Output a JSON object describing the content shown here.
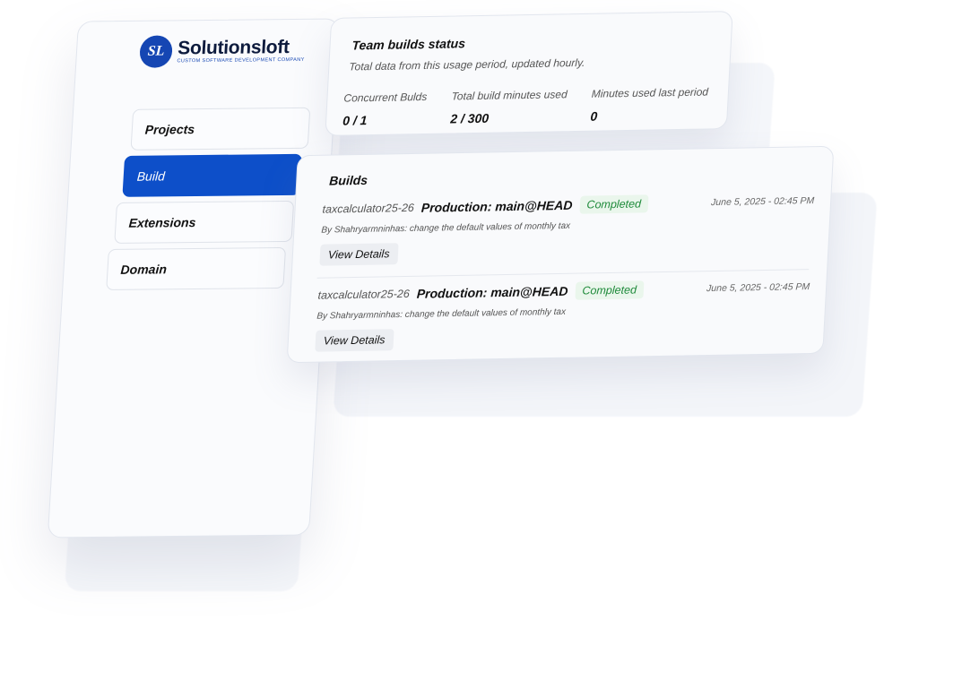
{
  "brand": {
    "name": "Solutionsloft",
    "tagline": "CUSTOM SOFTWARE DEVELOPMENT COMPANY",
    "mark": "SL",
    "accent": "#0d4fc9"
  },
  "sidebar": {
    "items": [
      {
        "label": "Projects",
        "active": false
      },
      {
        "label": "Build",
        "active": true
      },
      {
        "label": "Extensions",
        "active": false
      },
      {
        "label": "Domain",
        "active": false
      }
    ]
  },
  "status": {
    "title": "Team builds status",
    "subtitle": "Total data from this usage period, updated hourly.",
    "stats": [
      {
        "label": "Concurrent Bulds",
        "value": "0 / 1"
      },
      {
        "label": "Total build minutes used",
        "value": "2 / 300"
      },
      {
        "label": "Minutes used last period",
        "value": "0"
      }
    ]
  },
  "builds": {
    "title": "Builds",
    "items": [
      {
        "repo": "taxcalculator25-26",
        "env": "Production: main@HEAD",
        "status": "Completed",
        "date": "June 5, 2025 - 02:45 PM",
        "commit": "By Shahryarmninhas: change the default values of monthly tax",
        "action": "View Details"
      },
      {
        "repo": "taxcalculator25-26",
        "env": "Production: main@HEAD",
        "status": "Completed",
        "date": "June 5, 2025 - 02:45 PM",
        "commit": "By Shahryarmninhas: change the default values of monthly tax",
        "action": "View Details"
      }
    ]
  }
}
